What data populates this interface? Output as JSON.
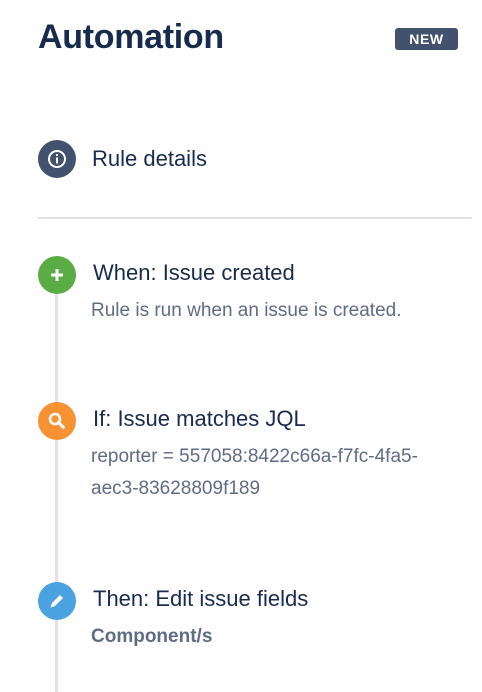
{
  "header": {
    "title": "Automation",
    "badge": "NEW"
  },
  "rule_details": {
    "label": "Rule details",
    "icon": "info-icon"
  },
  "steps": [
    {
      "heading": "When: Issue created",
      "description": "Rule is run when an issue is created.",
      "icon": "plus-icon",
      "color": "#5aac44"
    },
    {
      "heading": "If: Issue matches JQL",
      "description": "reporter = 557058:8422c66a-f7fc-4fa5-aec3-83628809f189",
      "icon": "search-icon",
      "color": "#f79232"
    },
    {
      "heading": "Then: Edit issue fields",
      "description": "Component/s",
      "icon": "pencil-icon",
      "color": "#4ba2e0"
    }
  ],
  "colors": {
    "title": "#172b4d",
    "badge_bg": "#42526e",
    "muted_text": "#5e6c84",
    "divider": "#dfe1e6"
  }
}
